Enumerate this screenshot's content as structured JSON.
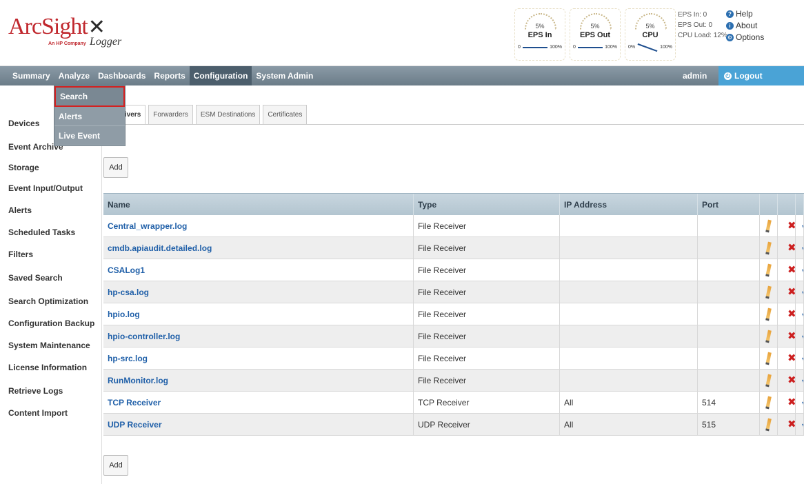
{
  "header": {
    "brand": "ArcSight",
    "brand_mark": "✕",
    "tagline": "An HP Company",
    "product": "Logger",
    "gauges": [
      {
        "pct": "5%",
        "label": "EPS In",
        "min": "0",
        "max": "100%"
      },
      {
        "pct": "5%",
        "label": "EPS Out",
        "min": "0",
        "max": "100%"
      },
      {
        "pct": "5%",
        "label": "CPU",
        "min": "0%",
        "max": "100%"
      }
    ],
    "stats": [
      "EPS In: 0",
      "EPS Out: 0",
      "CPU Load: 12%"
    ],
    "links": [
      {
        "label": "Help",
        "icon": "help-icon"
      },
      {
        "label": "About",
        "icon": "info-icon"
      },
      {
        "label": "Options",
        "icon": "gear-icon"
      }
    ]
  },
  "nav": {
    "items": [
      "Summary",
      "Analyze",
      "Dashboards",
      "Reports",
      "Configuration",
      "System Admin"
    ],
    "active": "Configuration",
    "user": "admin",
    "logout": "Logout"
  },
  "dropdown": {
    "items": [
      "Search",
      "Alerts",
      "Live Event Viewer"
    ],
    "selected": "Search"
  },
  "sidebar": {
    "items": [
      "Devices",
      "Event Archive",
      "Storage",
      "Event Input/Output",
      "Alerts",
      "Scheduled Tasks",
      "Filters",
      "Saved Search",
      "Search Optimization",
      "Configuration Backup",
      "System Maintenance",
      "License Information",
      "Retrieve Logs",
      "Content Import"
    ]
  },
  "subtabs": [
    "Receivers",
    "Forwarders",
    "ESM Destinations",
    "Certificates"
  ],
  "buttons": {
    "add_top": "Add",
    "add_bottom": "Add"
  },
  "table": {
    "columns": [
      "Name",
      "Type",
      "IP Address",
      "Port"
    ],
    "rows": [
      {
        "name": "Central_wrapper.log",
        "type": "File Receiver",
        "ip": "",
        "port": ""
      },
      {
        "name": "cmdb.apiaudit.detailed.log",
        "type": "File Receiver",
        "ip": "",
        "port": ""
      },
      {
        "name": "CSALog1",
        "type": "File Receiver",
        "ip": "",
        "port": ""
      },
      {
        "name": "hp-csa.log",
        "type": "File Receiver",
        "ip": "",
        "port": ""
      },
      {
        "name": "hpio.log",
        "type": "File Receiver",
        "ip": "",
        "port": ""
      },
      {
        "name": "hpio-controller.log",
        "type": "File Receiver",
        "ip": "",
        "port": ""
      },
      {
        "name": "hp-src.log",
        "type": "File Receiver",
        "ip": "",
        "port": ""
      },
      {
        "name": "RunMonitor.log",
        "type": "File Receiver",
        "ip": "",
        "port": ""
      },
      {
        "name": "TCP Receiver",
        "type": "TCP Receiver",
        "ip": "All",
        "port": "514"
      },
      {
        "name": "UDP Receiver",
        "type": "UDP Receiver",
        "ip": "All",
        "port": "515"
      }
    ]
  }
}
